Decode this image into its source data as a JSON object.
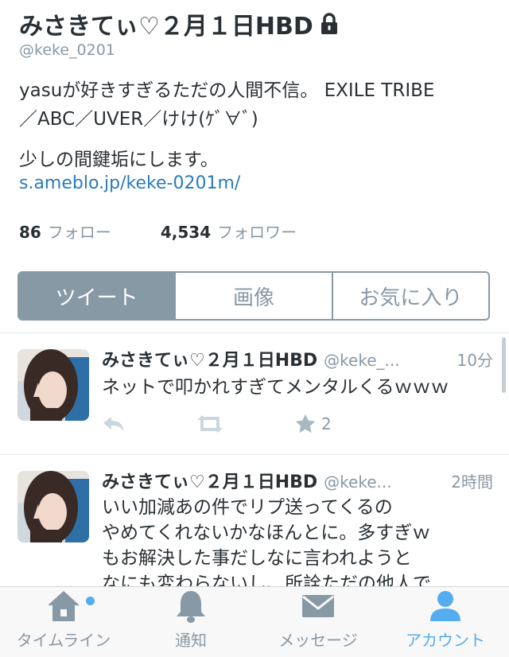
{
  "profile": {
    "display_name": "みさきてぃ♡２月１日HBD",
    "handle": "@keke_0201",
    "bio_line1": "yasuが好きすぎるただの人間不信。 EXILE TRIBE",
    "bio_line2": "／ABC／UVER／けけ(ｹﾞ∀ﾞ)",
    "bio_line3": "少しの間鍵垢にします。",
    "link": "s.ameblo.jp/keke-0201m/",
    "following_count": "86",
    "following_label": "フォロー",
    "followers_count": "4,534",
    "followers_label": "フォロワー"
  },
  "segments": [
    {
      "label": "ツイート",
      "active": true
    },
    {
      "label": "画像",
      "active": false
    },
    {
      "label": "お気に入り",
      "active": false
    }
  ],
  "tweets": [
    {
      "name": "みさきてぃ♡２月１日HBD",
      "handle": "@keke_...",
      "time": "10分",
      "text": "ネットで叩かれすぎてメンタルくるｗｗｗ",
      "favorite_count": "2"
    },
    {
      "name": "みさきてぃ♡２月１日HBD",
      "handle": "@keke...",
      "time": "2時間",
      "text_lines": [
        "いい加減あの件でリプ送ってくるの",
        "やめてくれないかなほんとに。多すぎｗ",
        "もお解決した事だしなに言われようと",
        "なにも変わらないし、所詮ただの他人で"
      ]
    }
  ],
  "tabbar": [
    {
      "label": "タイムライン",
      "icon": "home-icon",
      "active": false
    },
    {
      "label": "通知",
      "icon": "bell-icon",
      "active": false
    },
    {
      "label": "メッセージ",
      "icon": "envelope-icon",
      "active": false
    },
    {
      "label": "アカウント",
      "icon": "person-icon",
      "active": true
    }
  ],
  "colors": {
    "text": "#292f33",
    "muted": "#8899a6",
    "link": "#2b7bb9",
    "accent": "#55acee"
  }
}
